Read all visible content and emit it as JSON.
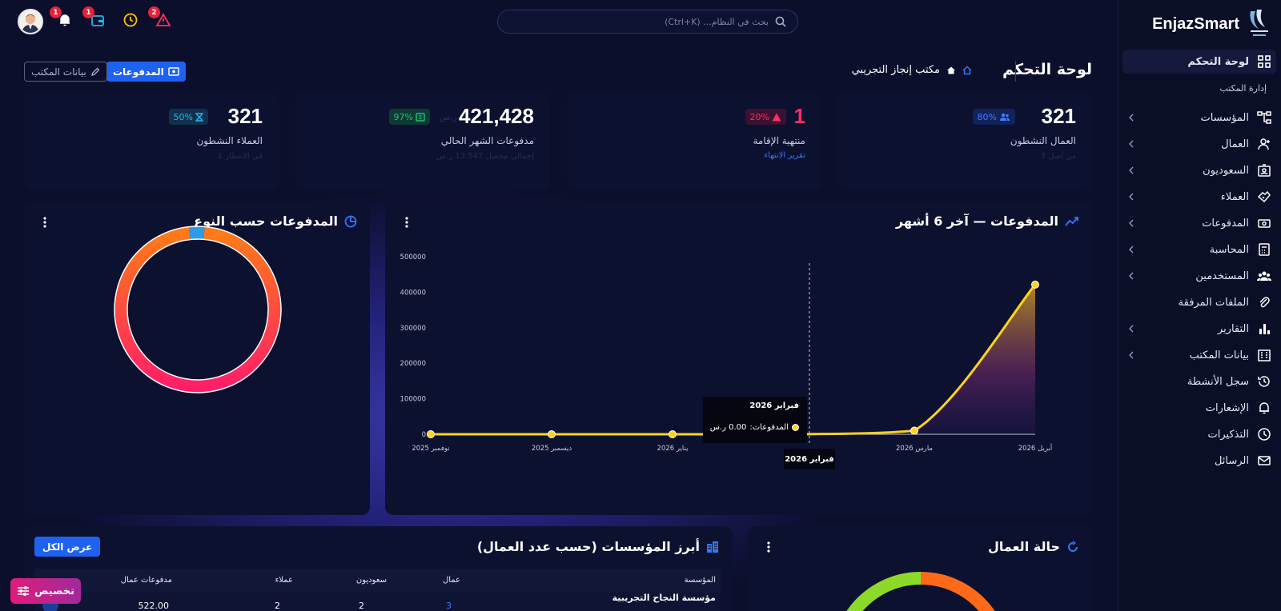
{
  "brand": {
    "name": "EnjazSmart"
  },
  "search": {
    "placeholder": "بحث في النظام... (Ctrl+K)"
  },
  "topbar": {
    "alerts_badge": "2",
    "notifications_badge": "1",
    "wallet_badge": "1"
  },
  "header": {
    "title": "لوحة التحكم",
    "breadcrumb": "مكتب إنجاز التجريبي",
    "payments_button": "المدفوعات",
    "office_button": "بيانات المكتب"
  },
  "sidebar": {
    "section_label": "إدارة المكتب",
    "items": [
      {
        "label": "لوحة التحكم",
        "icon": "dashboard-icon"
      },
      {
        "label": "المؤسسات",
        "icon": "org-icon"
      },
      {
        "label": "العمال",
        "icon": "worker-icon"
      },
      {
        "label": "السعوديون",
        "icon": "id-card-icon"
      },
      {
        "label": "العملاء",
        "icon": "handshake-icon"
      },
      {
        "label": "المدفوعات",
        "icon": "money-icon"
      },
      {
        "label": "المحاسبة",
        "icon": "calculator-icon"
      },
      {
        "label": "المستخدمين",
        "icon": "users-icon"
      },
      {
        "label": "الملفات المرفقة",
        "icon": "paperclip-icon"
      },
      {
        "label": "التقارير",
        "icon": "bar-chart-icon"
      },
      {
        "label": "بيانات المكتب",
        "icon": "building-icon"
      },
      {
        "label": "سجل الأنشطة",
        "icon": "history-icon"
      },
      {
        "label": "الإشعارات",
        "icon": "bell-icon"
      },
      {
        "label": "التذكيرات",
        "icon": "clock-icon"
      },
      {
        "label": "الرسائل",
        "icon": "mail-icon"
      }
    ]
  },
  "stats": [
    {
      "value": "321",
      "pill": "80%",
      "label": "العمال النشطون",
      "sub": "من أصل 3",
      "color": "#2f6bff"
    },
    {
      "value": "1",
      "pill": "20%",
      "label": "منتهية الإقامة",
      "link": "تقرير الانتهاء",
      "color": "#ff2e63"
    },
    {
      "value": "421,428",
      "unit": "ر.س",
      "pill": "97%",
      "label": "مدفوعات الشهر الحالي",
      "sub": "إجمالي محصل 13,547 ر.س",
      "color": "#19c37d"
    },
    {
      "value": "321",
      "pill": "50%",
      "label": "العملاء النشطون",
      "sub": "في الانتظار 1",
      "color": "#22b8e6"
    }
  ],
  "payments_chart": {
    "title": "المدفوعات — آخر 6 أشهر",
    "tooltip_title": "فبراير 2026",
    "tooltip_label": "المدفوعات:",
    "tooltip_value": "0.00 ر.س",
    "active_month": "فبراير 2026"
  },
  "chart_data": [
    {
      "type": "area",
      "title": "المدفوعات — آخر 6 أشهر",
      "categories": [
        "نوفمبر 2025",
        "ديسمبر 2025",
        "يناير 2026",
        "فبراير 2026",
        "مارس 2026",
        "أبريل 2026"
      ],
      "values": [
        0,
        0,
        0,
        0,
        10000,
        421428
      ],
      "ylim": [
        0,
        500000
      ],
      "yticks": [
        "0",
        "100000",
        "200000",
        "300000",
        "400000",
        "500000"
      ],
      "color": "#ffd21f"
    },
    {
      "type": "pie",
      "title": "المدفوعات حسب النوع",
      "slices": [
        97,
        3
      ],
      "colors": [
        "#ff5a3c",
        "#2e9be8"
      ]
    }
  ],
  "type_chart": {
    "title": "المدفوعات حسب النوع"
  },
  "workers_status": {
    "title": "حالة العمال"
  },
  "top_orgs": {
    "title": "أبرز المؤسسات (حسب عدد العمال)",
    "view_all": "عرض الكل",
    "columns": [
      "المؤسسة",
      "عمال",
      "سعوديون",
      "عملاء",
      "مدفوعات عمال"
    ],
    "rows": [
      {
        "name": "مؤسسة النجاح التجريبية",
        "workers": "3",
        "saudis": "2",
        "clients": "2",
        "payments": "522.00"
      }
    ]
  },
  "customize": {
    "label": "تخصيص"
  }
}
